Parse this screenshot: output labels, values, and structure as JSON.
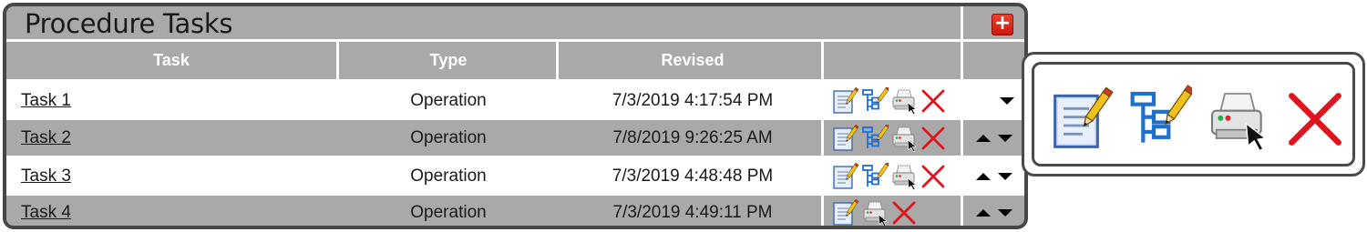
{
  "panel": {
    "title": "Procedure Tasks",
    "add_icon": "plus-icon",
    "add_label": "+"
  },
  "columns": [
    "Task",
    "Type",
    "Revised"
  ],
  "rows": [
    {
      "task": "Task 1",
      "type": "Operation",
      "revised": "7/3/2019 4:17:54 PM",
      "icons": [
        "edit-document-icon",
        "edit-tree-icon",
        "print-icon",
        "delete-icon"
      ],
      "arrows": [
        "down"
      ]
    },
    {
      "task": "Task 2",
      "type": "Operation",
      "revised": "7/8/2019 9:26:25 AM",
      "icons": [
        "edit-document-icon",
        "edit-tree-icon",
        "print-icon",
        "delete-icon"
      ],
      "arrows": [
        "up",
        "down"
      ]
    },
    {
      "task": "Task 3",
      "type": "Operation",
      "revised": "7/3/2019 4:48:48 PM",
      "icons": [
        "edit-document-icon",
        "edit-tree-icon",
        "print-icon",
        "delete-icon"
      ],
      "arrows": [
        "up",
        "down"
      ]
    },
    {
      "task": "Task 4",
      "type": "Operation",
      "revised": "7/3/2019 4:49:11 PM",
      "icons": [
        "edit-document-icon",
        "print-icon",
        "delete-icon"
      ],
      "arrows": [
        "up",
        "down"
      ]
    }
  ],
  "legend_icons": [
    "edit-document-icon",
    "edit-tree-icon",
    "print-icon",
    "delete-icon"
  ],
  "colors": {
    "panel_border": "#474747",
    "row_dark": "#a9a9a9",
    "row_light": "#ffffff",
    "delete_red": "#e0141e",
    "tree_blue": "#1f6fd0",
    "add_red": "#e22d1e"
  }
}
